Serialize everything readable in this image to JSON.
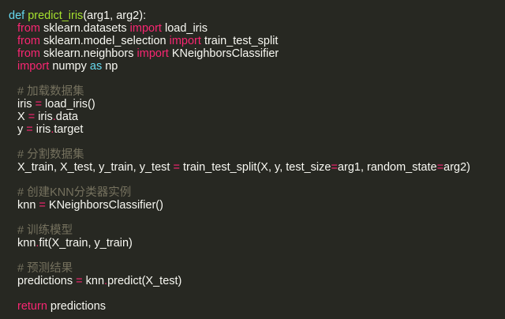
{
  "colors": {
    "background": "#272822",
    "text": "#f8f8f2",
    "keyword": "#f92672",
    "storage": "#66d9ef",
    "function": "#a6e22e",
    "comment": "#75715e"
  },
  "lines": [
    {
      "indent": 0,
      "tokens": [
        {
          "t": "def",
          "c": "def"
        },
        {
          "t": " ",
          "c": "tx"
        },
        {
          "t": "predict_iris",
          "c": "fn"
        },
        {
          "t": "(arg1, arg2):",
          "c": "tx"
        }
      ]
    },
    {
      "indent": 1,
      "tokens": [
        {
          "t": "from",
          "c": "kw"
        },
        {
          "t": " sklearn.datasets ",
          "c": "tx"
        },
        {
          "t": "import",
          "c": "kw"
        },
        {
          "t": " load_iris",
          "c": "tx"
        }
      ]
    },
    {
      "indent": 1,
      "tokens": [
        {
          "t": "from",
          "c": "kw"
        },
        {
          "t": " sklearn.model_selection ",
          "c": "tx"
        },
        {
          "t": "import",
          "c": "kw"
        },
        {
          "t": " train_test_split",
          "c": "tx"
        }
      ]
    },
    {
      "indent": 1,
      "tokens": [
        {
          "t": "from",
          "c": "kw"
        },
        {
          "t": " sklearn.neighbors ",
          "c": "tx"
        },
        {
          "t": "import",
          "c": "kw"
        },
        {
          "t": " KNeighborsClassifier",
          "c": "tx"
        }
      ]
    },
    {
      "indent": 1,
      "tokens": [
        {
          "t": "import",
          "c": "kw"
        },
        {
          "t": " numpy ",
          "c": "tx"
        },
        {
          "t": "as",
          "c": "def"
        },
        {
          "t": " np",
          "c": "tx"
        }
      ]
    },
    {
      "indent": 1,
      "tokens": []
    },
    {
      "indent": 1,
      "tokens": [
        {
          "t": "# 加载数据集",
          "c": "cm"
        }
      ]
    },
    {
      "indent": 1,
      "tokens": [
        {
          "t": "iris ",
          "c": "tx"
        },
        {
          "t": "=",
          "c": "kw"
        },
        {
          "t": " load_iris()",
          "c": "tx"
        }
      ]
    },
    {
      "indent": 1,
      "tokens": [
        {
          "t": "X ",
          "c": "tx"
        },
        {
          "t": "=",
          "c": "kw"
        },
        {
          "t": " iris",
          "c": "tx"
        },
        {
          "t": ".",
          "c": "kw"
        },
        {
          "t": "data",
          "c": "tx"
        }
      ]
    },
    {
      "indent": 1,
      "tokens": [
        {
          "t": "y ",
          "c": "tx"
        },
        {
          "t": "=",
          "c": "kw"
        },
        {
          "t": " iris",
          "c": "tx"
        },
        {
          "t": ".",
          "c": "kw"
        },
        {
          "t": "target",
          "c": "tx"
        }
      ]
    },
    {
      "indent": 1,
      "tokens": []
    },
    {
      "indent": 1,
      "tokens": [
        {
          "t": "# 分割数据集",
          "c": "cm"
        }
      ]
    },
    {
      "indent": 1,
      "tokens": [
        {
          "t": "X_train, X_test, y_train, y_test ",
          "c": "tx"
        },
        {
          "t": "=",
          "c": "kw"
        },
        {
          "t": " train_test_split(X, y, test_size",
          "c": "tx"
        },
        {
          "t": "=",
          "c": "kw"
        },
        {
          "t": "arg1, random_state",
          "c": "tx"
        },
        {
          "t": "=",
          "c": "kw"
        },
        {
          "t": "arg2)",
          "c": "tx"
        }
      ]
    },
    {
      "indent": 1,
      "tokens": []
    },
    {
      "indent": 1,
      "tokens": [
        {
          "t": "# 创建KNN分类器实例",
          "c": "cm"
        }
      ]
    },
    {
      "indent": 1,
      "tokens": [
        {
          "t": "knn ",
          "c": "tx"
        },
        {
          "t": "=",
          "c": "kw"
        },
        {
          "t": " KNeighborsClassifier()",
          "c": "tx"
        }
      ]
    },
    {
      "indent": 1,
      "tokens": []
    },
    {
      "indent": 1,
      "tokens": [
        {
          "t": "# 训练模型",
          "c": "cm"
        }
      ]
    },
    {
      "indent": 1,
      "tokens": [
        {
          "t": "knn",
          "c": "tx"
        },
        {
          "t": ".",
          "c": "kw"
        },
        {
          "t": "fit(X_train, y_train)",
          "c": "tx"
        }
      ]
    },
    {
      "indent": 1,
      "tokens": []
    },
    {
      "indent": 1,
      "tokens": [
        {
          "t": "# 预测结果",
          "c": "cm"
        }
      ]
    },
    {
      "indent": 1,
      "tokens": [
        {
          "t": "predictions ",
          "c": "tx"
        },
        {
          "t": "=",
          "c": "kw"
        },
        {
          "t": " knn",
          "c": "tx"
        },
        {
          "t": ".",
          "c": "kw"
        },
        {
          "t": "predict(X_test)",
          "c": "tx"
        }
      ]
    },
    {
      "indent": 1,
      "tokens": []
    },
    {
      "indent": 1,
      "tokens": [
        {
          "t": "return",
          "c": "kw"
        },
        {
          "t": " predictions",
          "c": "tx"
        }
      ]
    }
  ]
}
